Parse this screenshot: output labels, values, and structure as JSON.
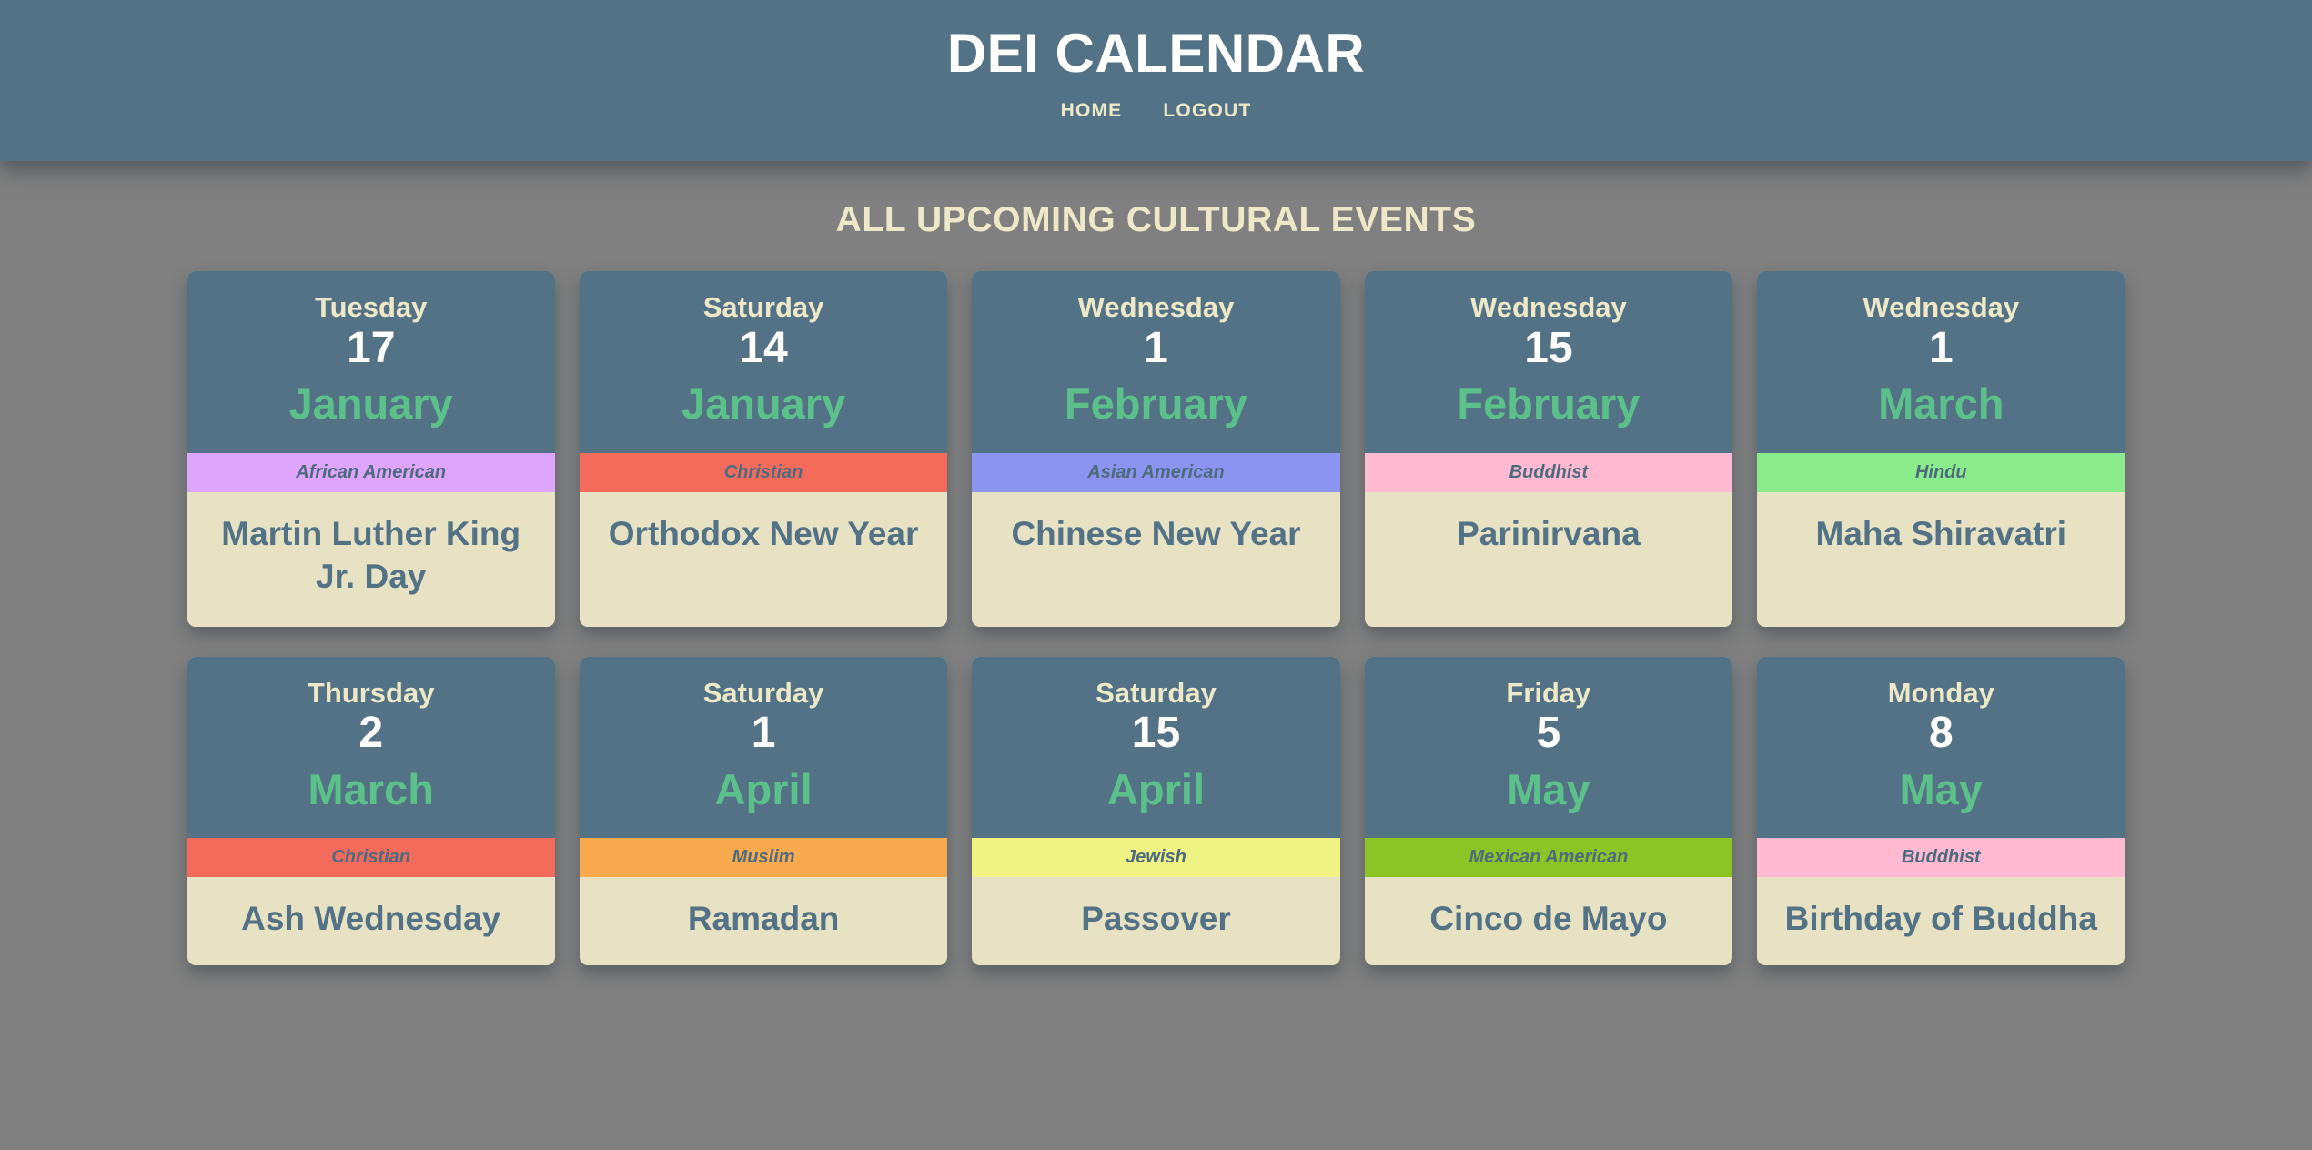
{
  "header": {
    "title": "DEI CALENDAR",
    "nav": [
      {
        "label": "HOME"
      },
      {
        "label": "LOGOUT"
      }
    ]
  },
  "main": {
    "page_title": "ALL UPCOMING CULTURAL EVENTS"
  },
  "colors": {
    "header_bg": "#547286",
    "page_bg": "#808080",
    "card_top_bg": "#547286",
    "card_body_bg": "#e6e2c3",
    "weekday_text": "#ece8c8",
    "day_text": "#ffffff",
    "month_text": "#5cc08b",
    "event_text": "#547286",
    "category_text": "#4e6b7e"
  },
  "events": [
    {
      "weekday": "Tuesday",
      "day": "17",
      "month": "January",
      "category": "African American",
      "category_color": "#dda5fb",
      "name": "Martin Luther King Jr. Day"
    },
    {
      "weekday": "Saturday",
      "day": "14",
      "month": "January",
      "category": "Christian",
      "category_color": "#f46b5c",
      "name": "Orthodox New Year"
    },
    {
      "weekday": "Wednesday",
      "day": "1",
      "month": "February",
      "category": "Asian American",
      "category_color": "#8b95f0",
      "name": "Chinese New Year"
    },
    {
      "weekday": "Wednesday",
      "day": "15",
      "month": "February",
      "category": "Buddhist",
      "category_color": "#ffbad2",
      "name": "Parinirvana"
    },
    {
      "weekday": "Wednesday",
      "day": "1",
      "month": "March",
      "category": "Hindu",
      "category_color": "#8ceb8c",
      "name": "Maha Shiravatri"
    },
    {
      "weekday": "Thursday",
      "day": "2",
      "month": "March",
      "category": "Christian",
      "category_color": "#f46b5c",
      "name": "Ash Wednesday"
    },
    {
      "weekday": "Saturday",
      "day": "1",
      "month": "April",
      "category": "Muslim",
      "category_color": "#f9a94e",
      "name": "Ramadan"
    },
    {
      "weekday": "Saturday",
      "day": "15",
      "month": "April",
      "category": "Jewish",
      "category_color": "#eff383",
      "name": "Passover"
    },
    {
      "weekday": "Friday",
      "day": "5",
      "month": "May",
      "category": "Mexican American",
      "category_color": "#8cc426",
      "name": "Cinco de Mayo"
    },
    {
      "weekday": "Monday",
      "day": "8",
      "month": "May",
      "category": "Buddhist",
      "category_color": "#ffbad2",
      "name": "Birthday of Buddha"
    }
  ]
}
